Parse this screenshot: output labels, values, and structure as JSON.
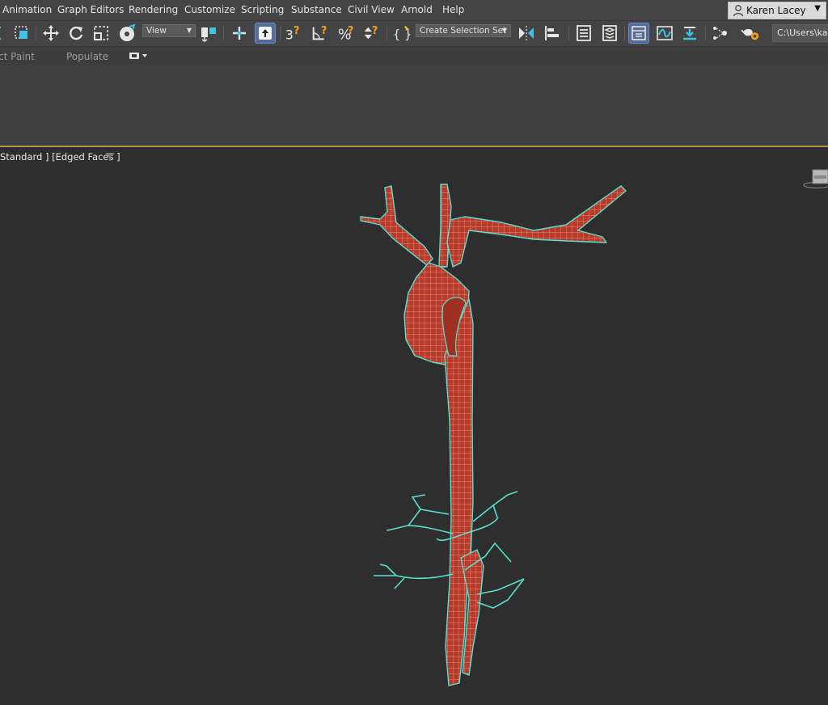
{
  "menubar": {
    "items": [
      "Animation",
      "Graph Editors",
      "Rendering",
      "Customize",
      "Scripting",
      "Substance",
      "Civil View",
      "Arnold",
      "Help"
    ],
    "user_name": "Karen Lacey"
  },
  "toolbar": {
    "reference_coord": "View",
    "selection_set_placeholder": "Create Selection Set",
    "project_path": "C:\\Users\\kare"
  },
  "ribbon": {
    "tabs": [
      "ct Paint",
      "Populate"
    ]
  },
  "viewport": {
    "label": "Standard ] [Edged Faces ]"
  },
  "colors": {
    "accent": "#5e8fd6",
    "viewport_border": "#b59b4c",
    "mesh_fill": "#b83a2a",
    "wireframe": "#59e0d0"
  }
}
